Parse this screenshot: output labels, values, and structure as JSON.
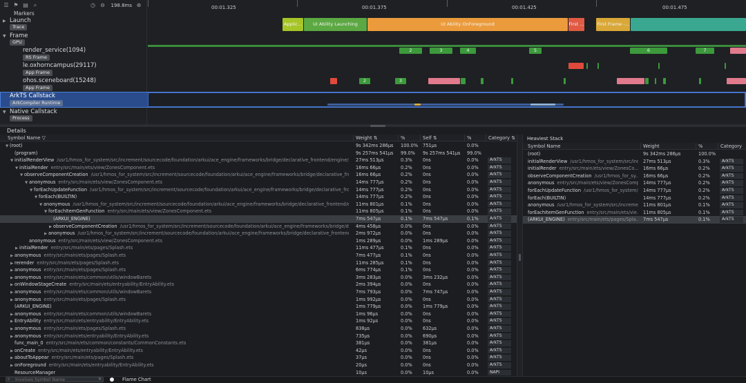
{
  "toolbar": {
    "icons": [
      "menu-icon",
      "flag-icon",
      "trash-icon",
      "search-icon"
    ],
    "zoom_label": "198.8ms",
    "markers_label": "Markers"
  },
  "ruler": {
    "ticks": [
      {
        "label": "00:01.325"
      },
      {
        "label": "00:01.375"
      },
      {
        "label": "00:01.425"
      },
      {
        "label": "00:01.475"
      }
    ]
  },
  "tracks": {
    "launch": {
      "name": "Launch",
      "badge": "Trace"
    },
    "frame": {
      "name": "Frame",
      "badge": "GPU"
    },
    "render_service": {
      "name": "render_service(1094)",
      "badge": "RS Frame"
    },
    "app1": {
      "name": "le.oxhorncampus(29117)",
      "badge": "App Frame"
    },
    "app2": {
      "name": "ohos.sceneboard(15248)",
      "badge": "App Frame"
    },
    "arkts": {
      "name": "ArkTS Callstack",
      "badge": "ArkCompiler Runtime"
    },
    "native": {
      "name": "Native Callstack",
      "badge": "Process"
    }
  },
  "launch_bars": [
    {
      "label": "Applic...",
      "color": "#a6c526"
    },
    {
      "label": "UI Ability Launching",
      "color": "#5ca843"
    },
    {
      "label": "UI Ability OnForeground",
      "color": "#eb9b3c"
    },
    {
      "label": "First ...",
      "color": "#e05a44"
    },
    {
      "label": "First Frame -...",
      "color": "#d9a838"
    },
    {
      "label": "",
      "color": "#3aa890"
    }
  ],
  "rs_frames": [
    "2",
    "3",
    "4",
    "5",
    "6",
    "7"
  ],
  "app2_frames": [
    "2",
    "3"
  ],
  "details": {
    "title": "Details",
    "columns": [
      "Symbol Name",
      "Weight",
      "%",
      "Self",
      "%",
      "Category"
    ],
    "rows": [
      {
        "name": "(root)",
        "path": "",
        "weight": "9s 342ms 286μs",
        "wpct": "100.0%",
        "self": "751μs",
        "spct": "0.0%",
        "cat": ""
      },
      {
        "name": "(program)",
        "path": "",
        "weight": "9s 257ms 541μs",
        "wpct": "99.0%",
        "self": "9s 257ms 541μs",
        "spct": "99.0%",
        "cat": ""
      },
      {
        "name": "initialRenderView",
        "path": "/usr1/hmos_for_system/src/increment/sourcecode/foundation/arkui/ace_engine/frameworks/bridge/declarative_frontend/engine/stat",
        "weight": "27ms 513μs",
        "wpct": "0.3%",
        "self": "0ns",
        "spct": "0.0%",
        "cat": "ArkTS"
      },
      {
        "name": "initialRender",
        "path": "entry/src/main/ets/view/ZonesComponent.ets",
        "weight": "16ms 66μs",
        "wpct": "0.2%",
        "self": "0ns",
        "spct": "0.0%",
        "cat": "ArkTS"
      },
      {
        "name": "observeComponentCreation",
        "path": "/usr1/hmos_for_system/src/increment/sourcecode/foundation/arkui/ace_engine/frameworks/bridge/declarative_front...",
        "weight": "16ms 66μs",
        "wpct": "0.2%",
        "self": "0ns",
        "spct": "0.0%",
        "cat": "ArkTS"
      },
      {
        "name": "anonymous",
        "path": "entry/src/main/ets/view/ZonesComponent.ets",
        "weight": "14ms 777μs",
        "wpct": "0.2%",
        "self": "0ns",
        "spct": "0.0%",
        "cat": "ArkTS"
      },
      {
        "name": "forEachUpdateFunction",
        "path": "/usr1/hmos_for_system/src/increment/sourcecode/foundation/arkui/ace_engine/frameworks/bridge/declarative_fron...",
        "weight": "14ms 777μs",
        "wpct": "0.2%",
        "self": "0ns",
        "spct": "0.0%",
        "cat": "ArkTS"
      },
      {
        "name": "forEach(BUILTIN)",
        "path": "",
        "weight": "14ms 777μs",
        "wpct": "0.2%",
        "self": "0ns",
        "spct": "0.0%",
        "cat": "ArkTS"
      },
      {
        "name": "anonymous",
        "path": "/usr1/hmos_for_system/src/increment/sourcecode/foundation/arkui/ace_engine/frameworks/bridge/declarative_frontend/e...",
        "weight": "11ms 801μs",
        "wpct": "0.1%",
        "self": "0ns",
        "spct": "0.0%",
        "cat": "ArkTS"
      },
      {
        "name": "forEachItemGenFunction",
        "path": "entry/src/main/ets/view/ZonesComponent.ets",
        "weight": "11ms 805μs",
        "wpct": "0.1%",
        "self": "0ns",
        "spct": "0.0%",
        "cat": "ArkTS"
      },
      {
        "name": "(ARKUI_ENGINE)",
        "path": "",
        "weight": "7ms 547μs",
        "wpct": "0.1%",
        "self": "7ms 547μs",
        "spct": "0.1%",
        "cat": "ArkTS"
      },
      {
        "name": "observeComponentCreation",
        "path": "/usr1/hmos_for_system/src/increment/sourcecode/foundation/arkui/ace_engine/frameworks/bridge/declarative_frontend/e...",
        "weight": "4ms 458μs",
        "wpct": "0.0%",
        "self": "0ns",
        "spct": "0.0%",
        "cat": "ArkTS"
      },
      {
        "name": "anonymous",
        "path": "/usr1/hmos_for_system/src/increment/sourcecode/foundation/arkui/ace_engine/frameworks/bridge/declarative_frontend/e...",
        "weight": "2ms 972μs",
        "wpct": "0.0%",
        "self": "0ns",
        "spct": "0.0%",
        "cat": "ArkTS"
      },
      {
        "name": "anonymous",
        "path": "entry/src/main/ets/view/ZonesComponent.ets",
        "weight": "1ms 289μs",
        "wpct": "0.0%",
        "self": "1ms 289μs",
        "spct": "0.0%",
        "cat": "ArkTS"
      },
      {
        "name": "initialRender",
        "path": "entry/src/main/ets/pages/Splash.ets",
        "weight": "11ms 477μs",
        "wpct": "0.1%",
        "self": "0ns",
        "spct": "0.0%",
        "cat": "ArkTS"
      },
      {
        "name": "anonymous",
        "path": "entry/src/main/ets/pages/Splash.ets",
        "weight": "7ms 477μs",
        "wpct": "0.1%",
        "self": "0ns",
        "spct": "0.0%",
        "cat": "ArkTS"
      },
      {
        "name": "rerender",
        "path": "entry/src/main/ets/pages/Splash.ets",
        "weight": "11ms 285μs",
        "wpct": "0.1%",
        "self": "0ns",
        "spct": "0.0%",
        "cat": "ArkTS"
      },
      {
        "name": "anonymous",
        "path": "entry/src/main/ets/pages/Splash.ets",
        "weight": "6ms 774μs",
        "wpct": "0.1%",
        "self": "0ns",
        "spct": "0.0%",
        "cat": "ArkTS"
      },
      {
        "name": "anonymous",
        "path": "entry/src/main/ets/common/utils/windowBarets",
        "weight": "3ms 283μs",
        "wpct": "0.0%",
        "self": "3ms 232μs",
        "spct": "0.0%",
        "cat": "ArkTS"
      },
      {
        "name": "onWindowStageCreate",
        "path": "entry/src/main/ets/entryability/EntryAbility.ets",
        "weight": "2ms 394μs",
        "wpct": "0.0%",
        "self": "0ns",
        "spct": "0.0%",
        "cat": "ArkTS"
      },
      {
        "name": "anonymous",
        "path": "entry/src/main/ets/common/utils/windowBarets",
        "weight": "7ms 793μs",
        "wpct": "0.0%",
        "self": "7ms 747μs",
        "spct": "0.0%",
        "cat": "ArkTS"
      },
      {
        "name": "anonymous",
        "path": "entry/src/main/ets/pages/Splash.ets",
        "weight": "1ms 992μs",
        "wpct": "0.0%",
        "self": "0ns",
        "spct": "0.0%",
        "cat": "ArkTS"
      },
      {
        "name": "(ARKUI_ENGINE)",
        "path": "",
        "weight": "1ms 779μs",
        "wpct": "0.0%",
        "self": "1ms 779μs",
        "spct": "0.0%",
        "cat": "ArkTS"
      },
      {
        "name": "anonymous",
        "path": "entry/src/main/ets/common/utils/windowBarets",
        "weight": "1ms 96μs",
        "wpct": "0.0%",
        "self": "0ns",
        "spct": "0.0%",
        "cat": "ArkTS"
      },
      {
        "name": "EntryAbility",
        "path": "entry/src/main/ets/entryability/EntryAbility.ets",
        "weight": "1ms 92μs",
        "wpct": "0.0%",
        "self": "0ns",
        "spct": "0.0%",
        "cat": "ArkTS"
      },
      {
        "name": "anonymous",
        "path": "entry/src/main/ets/pages/Splash.ets",
        "weight": "838μs",
        "wpct": "0.0%",
        "self": "632μs",
        "spct": "0.0%",
        "cat": "ArkTS"
      },
      {
        "name": "anonymous",
        "path": "entry/src/main/ets/entryability/EntryAbility.ets",
        "weight": "735μs",
        "wpct": "0.0%",
        "self": "690μs",
        "spct": "0.0%",
        "cat": "ArkTS"
      },
      {
        "name": "func_main_0",
        "path": "entry/src/main/ets/common/constants/CommonConstants.ets",
        "weight": "381μs",
        "wpct": "0.0%",
        "self": "381μs",
        "spct": "0.0%",
        "cat": "ArkTS"
      },
      {
        "name": "onCreate",
        "path": "entry/src/main/ets/entryability/EntryAbility.ets",
        "weight": "42μs",
        "wpct": "0.0%",
        "self": "0ns",
        "spct": "0.0%",
        "cat": "ArkTS"
      },
      {
        "name": "aboutToAppear",
        "path": "entry/src/main/ets/pages/Splash.ets",
        "weight": "37μs",
        "wpct": "0.0%",
        "self": "0ns",
        "spct": "0.0%",
        "cat": "ArkTS"
      },
      {
        "name": "onForeground",
        "path": "entry/src/main/ets/entryability/EntryAbility.ets",
        "weight": "20μs",
        "wpct": "0.0%",
        "self": "0ns",
        "spct": "0.0%",
        "cat": "ArkTS"
      },
      {
        "name": "ResourceManager",
        "path": "",
        "weight": "10μs",
        "wpct": "0.0%",
        "self": "10μs",
        "spct": "0.0%",
        "cat": "NAPI"
      }
    ]
  },
  "heaviest": {
    "title": "Heaviest Stack",
    "columns": [
      "Symbol Name",
      "Weight",
      "%",
      "Category"
    ],
    "rows": [
      {
        "name": "(root)",
        "path": "",
        "weight": "9s 342ms 286μs",
        "pct": "100.0%",
        "cat": ""
      },
      {
        "name": "initialRenderView",
        "path": "/usr1/hmos_for_system/src/incre...",
        "weight": "27ms 513μs",
        "pct": "0.3%",
        "cat": "ArkTS"
      },
      {
        "name": "initialRender",
        "path": "entry/src/main/ets/view/ZonesCo...",
        "weight": "16ms 66μs",
        "pct": "0.2%",
        "cat": "ArkTS"
      },
      {
        "name": "observeComponentCreation",
        "path": "/usr1/hmos_for_sy...",
        "weight": "16ms 66μs",
        "pct": "0.2%",
        "cat": "ArkTS"
      },
      {
        "name": "anonymous",
        "path": "entry/src/main/ets/view/ZonesCompo...",
        "weight": "14ms 777μs",
        "pct": "0.2%",
        "cat": "ArkTS"
      },
      {
        "name": "forEachUpdateFunction",
        "path": "/usr1/hmos_for_system/...",
        "weight": "14ms 777μs",
        "pct": "0.2%",
        "cat": "ArkTS"
      },
      {
        "name": "forEach(BUILTIN)",
        "path": "",
        "weight": "14ms 777μs",
        "pct": "0.2%",
        "cat": "ArkTS"
      },
      {
        "name": "anonymous",
        "path": "/usr1/hmos_for_system/src/increme...",
        "weight": "11ms 801μs",
        "pct": "0.1%",
        "cat": "ArkTS"
      },
      {
        "name": "forEachItemGenFunction",
        "path": "entry/src/main/ets/vie...",
        "weight": "11ms 805μs",
        "pct": "0.1%",
        "cat": "ArkTS"
      },
      {
        "name": "(ARKUI_ENGINE)",
        "path": "entry/src/main/ets/pages/Spla...",
        "weight": "7ms 547μs",
        "pct": "0.1%",
        "cat": "ArkTS"
      }
    ]
  },
  "bottom": {
    "filter_placeholder": "Involves Symbol Name",
    "flame_label": "Flame Chart"
  }
}
